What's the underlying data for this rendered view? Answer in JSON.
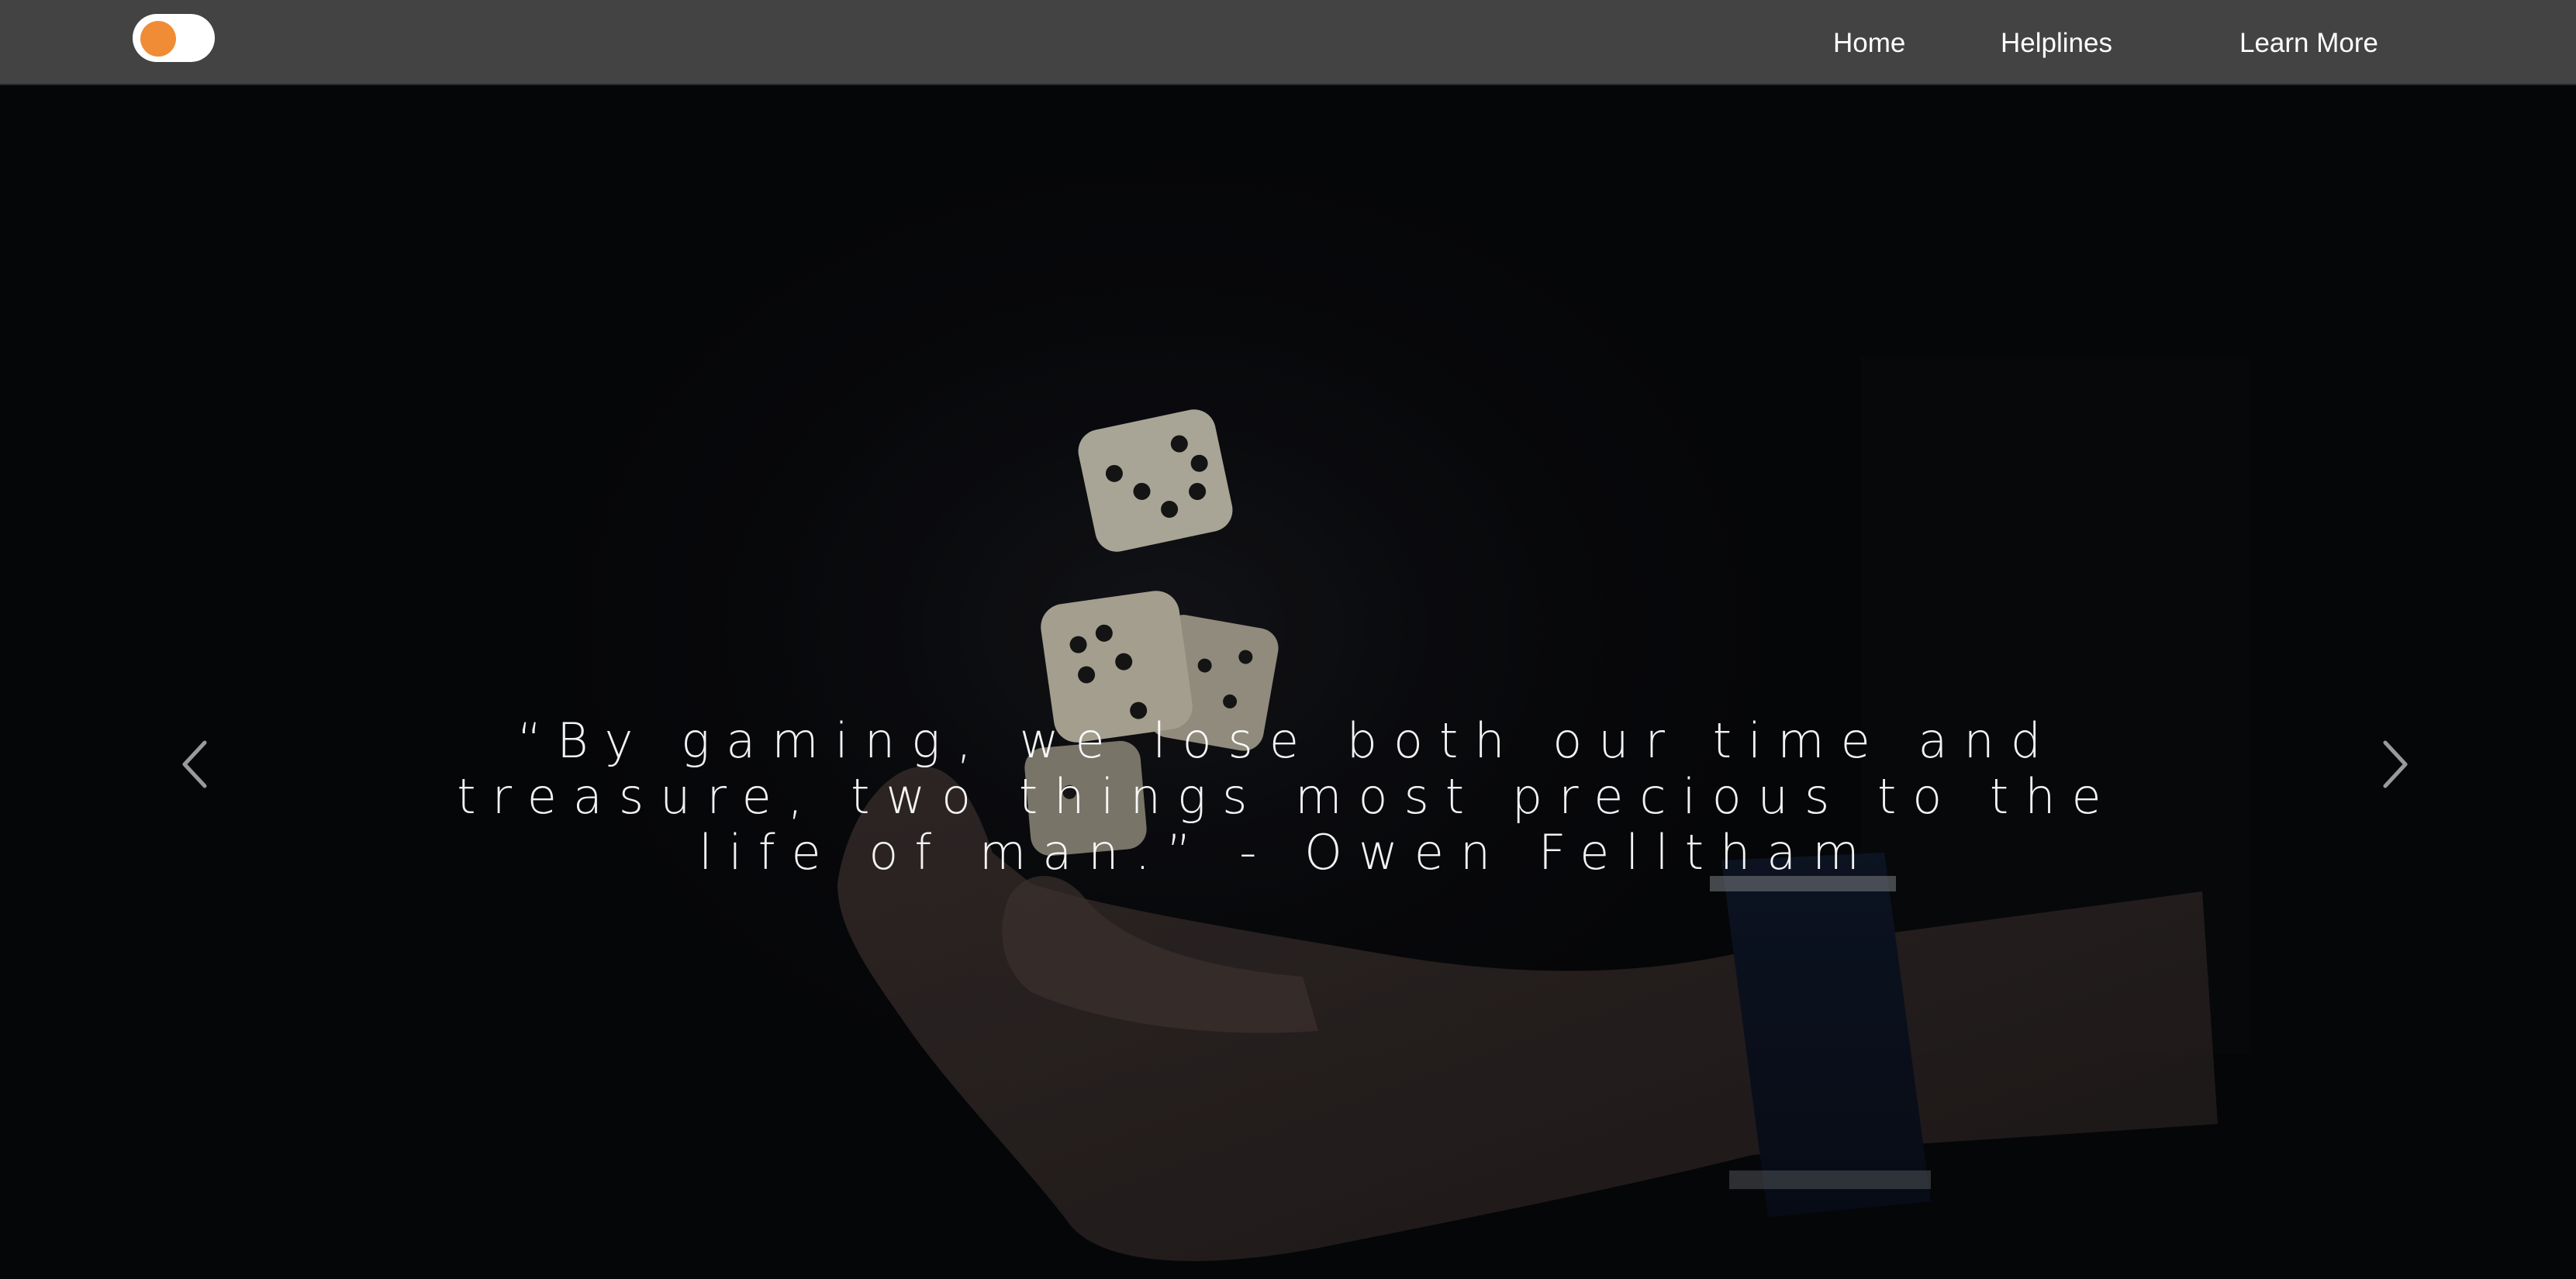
{
  "nav": {
    "theme_toggle": {
      "state": "off",
      "knob_color": "#f08c36"
    },
    "links": [
      {
        "label": "Home"
      },
      {
        "label": "Helplines"
      },
      {
        "label": "Learn More"
      }
    ]
  },
  "hero": {
    "quote": "“By gaming, we lose both our time and treasure, two things most precious to the life of man.” - Owen Felltham",
    "prev_icon": "chevron-left-icon",
    "next_icon": "chevron-right-icon"
  },
  "colors": {
    "navbar_bg": "#434343",
    "hero_bg": "#07080b",
    "accent": "#f08c36",
    "text": "#ffffff"
  }
}
